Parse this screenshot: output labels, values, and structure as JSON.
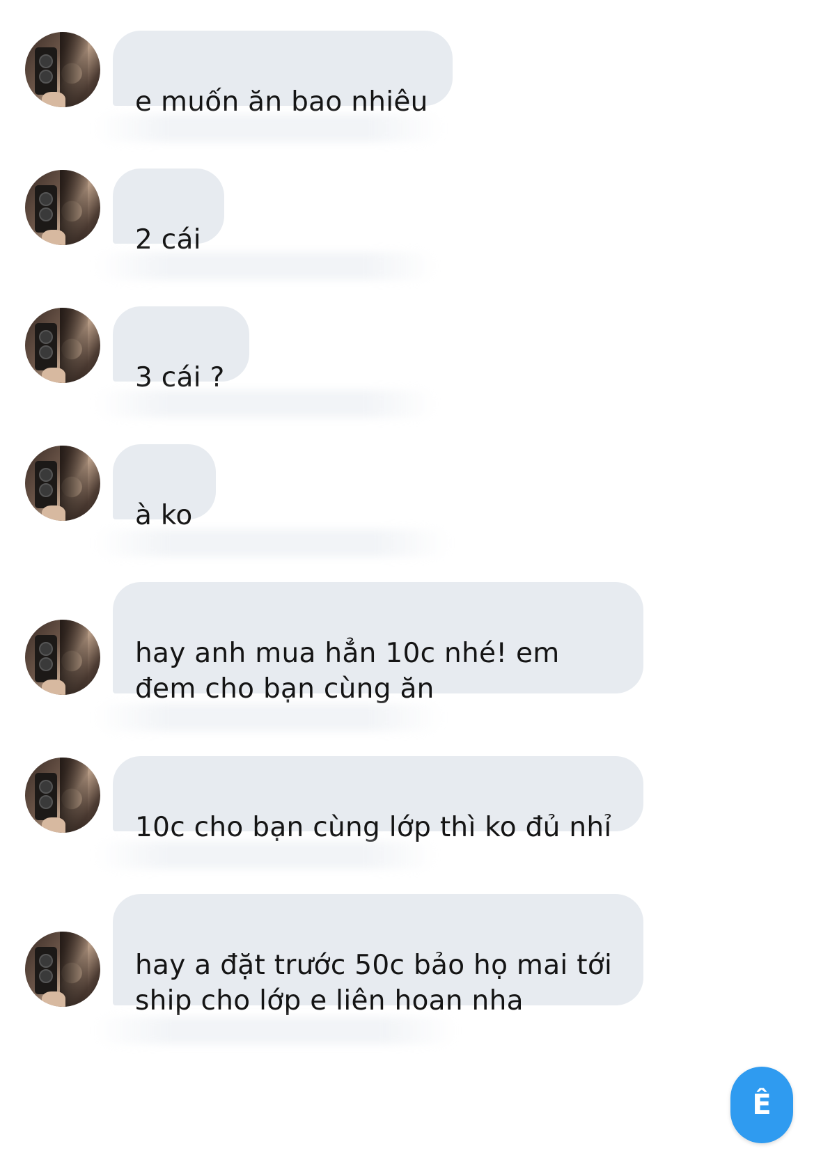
{
  "messages": [
    {
      "text": "e muốn ăn bao nhiêu"
    },
    {
      "text": "2 cái"
    },
    {
      "text": "3 cái ?"
    },
    {
      "text": "à ko"
    },
    {
      "text": "hay anh mua hẳn 10c nhé! em\nđem cho bạn cùng ăn"
    },
    {
      "text": "10c cho bạn cùng lớp thì ko đủ nhỉ"
    },
    {
      "text": "hay a đặt trước 50c bảo họ mai tới\nship cho lớp e liên hoan nha"
    }
  ],
  "colors": {
    "bubble": "#e7ebf0",
    "fab": "#2f9bf0"
  },
  "fab": {
    "label": "Ê",
    "icon": "app-logo-icon"
  }
}
